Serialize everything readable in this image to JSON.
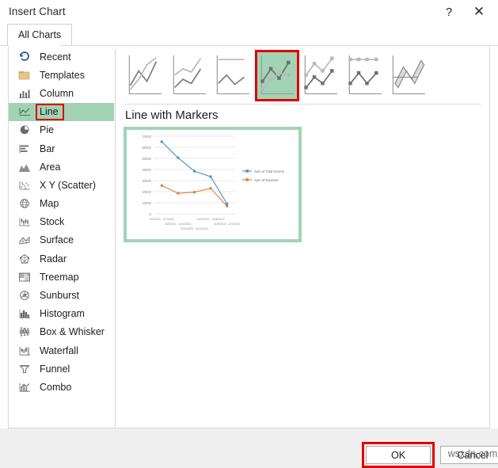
{
  "window": {
    "title": "Insert Chart",
    "help_label": "?",
    "close_label": "✕"
  },
  "tabs": [
    {
      "label": "All Charts",
      "selected": true
    }
  ],
  "sidebar": {
    "items": [
      {
        "label": "Recent",
        "icon": "recent-icon",
        "selected": false
      },
      {
        "label": "Templates",
        "icon": "templates-icon",
        "selected": false
      },
      {
        "label": "Column",
        "icon": "column-icon",
        "selected": false
      },
      {
        "label": "Line",
        "icon": "line-icon",
        "selected": true
      },
      {
        "label": "Pie",
        "icon": "pie-icon",
        "selected": false
      },
      {
        "label": "Bar",
        "icon": "bar-icon",
        "selected": false
      },
      {
        "label": "Area",
        "icon": "area-icon",
        "selected": false
      },
      {
        "label": "X Y (Scatter)",
        "icon": "scatter-icon",
        "selected": false
      },
      {
        "label": "Map",
        "icon": "map-icon",
        "selected": false
      },
      {
        "label": "Stock",
        "icon": "stock-icon",
        "selected": false
      },
      {
        "label": "Surface",
        "icon": "surface-icon",
        "selected": false
      },
      {
        "label": "Radar",
        "icon": "radar-icon",
        "selected": false
      },
      {
        "label": "Treemap",
        "icon": "treemap-icon",
        "selected": false
      },
      {
        "label": "Sunburst",
        "icon": "sunburst-icon",
        "selected": false
      },
      {
        "label": "Histogram",
        "icon": "histogram-icon",
        "selected": false
      },
      {
        "label": "Box & Whisker",
        "icon": "box-whisker-icon",
        "selected": false
      },
      {
        "label": "Waterfall",
        "icon": "waterfall-icon",
        "selected": false
      },
      {
        "label": "Funnel",
        "icon": "funnel-icon",
        "selected": false
      },
      {
        "label": "Combo",
        "icon": "combo-icon",
        "selected": false
      }
    ]
  },
  "chart_types": [
    {
      "name": "Line",
      "selected": false
    },
    {
      "name": "Stacked Line",
      "selected": false
    },
    {
      "name": "100% Stacked Line",
      "selected": false
    },
    {
      "name": "Line with Markers",
      "selected": true
    },
    {
      "name": "Stacked Line with Markers",
      "selected": false
    },
    {
      "name": "100% Stacked Line with Markers",
      "selected": false
    },
    {
      "name": "3-D Line",
      "selected": false
    }
  ],
  "preview": {
    "title": "Line with Markers"
  },
  "footer": {
    "ok_label": "OK",
    "cancel_label": "Cancel",
    "watermark": "wsxdn.com"
  },
  "colors": {
    "selection_green": "#a2d3b5",
    "selection_red": "#e00000",
    "series_blue": "#4a90c4",
    "series_orange": "#e07b39",
    "dialog_bg": "#ffffff",
    "footer_bg": "#efefef"
  },
  "chart_data": {
    "type": "line",
    "title": "",
    "xlabel": "",
    "ylabel": "",
    "ylim": [
      0,
      70000
    ],
    "yticks": [
      "0",
      "10000",
      "20000",
      "30000",
      "40000",
      "50000",
      "60000",
      "70000"
    ],
    "grid": true,
    "legend_position": "right",
    "categories": [
      "4/1/2022 - 4/7/2022",
      "4/8/2022 - 4/14/2022",
      "4/15/2022 - 4/21/2022",
      "4/22/2022 - 4/28/2022",
      "4/29/2022 - 5/1/2022"
    ],
    "series": [
      {
        "name": "Sum of Total Income",
        "color": "#4a90c4",
        "values": [
          65000,
          50500,
          38500,
          33500,
          9000
        ]
      },
      {
        "name": "Sum of Expense",
        "color": "#e07b39",
        "values": [
          25500,
          18500,
          19500,
          23000,
          7000
        ]
      }
    ]
  }
}
